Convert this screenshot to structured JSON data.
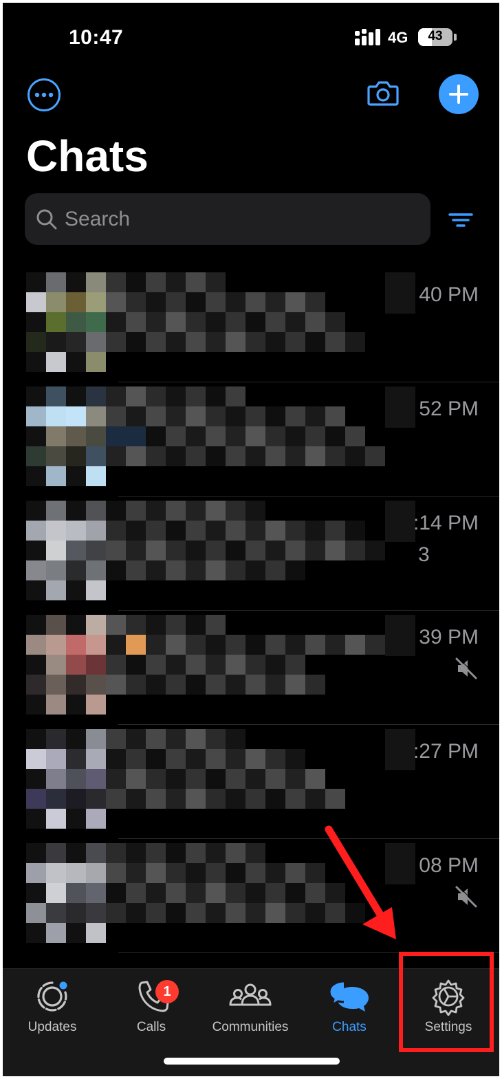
{
  "status": {
    "time": "10:47",
    "network": "4G",
    "battery": "43"
  },
  "header": {
    "title": "Chats",
    "accent": "#3b9dff"
  },
  "search": {
    "placeholder": "Search"
  },
  "chats": [
    {
      "time": "40 PM",
      "unread": "",
      "muted": false
    },
    {
      "time": "52 PM",
      "unread": "",
      "muted": false
    },
    {
      "time": ":14 PM",
      "unread": "3",
      "muted": false
    },
    {
      "time": "39 PM",
      "unread": "",
      "muted": true
    },
    {
      "time": ":27 PM",
      "unread": "",
      "muted": false
    },
    {
      "time": "08 PM",
      "unread": "",
      "muted": true
    }
  ],
  "tabs": [
    {
      "label": "Updates",
      "icon": "updates-icon"
    },
    {
      "label": "Calls",
      "icon": "phone-icon",
      "badge": "1"
    },
    {
      "label": "Communities",
      "icon": "communities-icon"
    },
    {
      "label": "Chats",
      "icon": "chats-icon",
      "active": true
    },
    {
      "label": "Settings",
      "icon": "gear-icon"
    }
  ],
  "annotation": {
    "color": "#ff1e1e"
  }
}
